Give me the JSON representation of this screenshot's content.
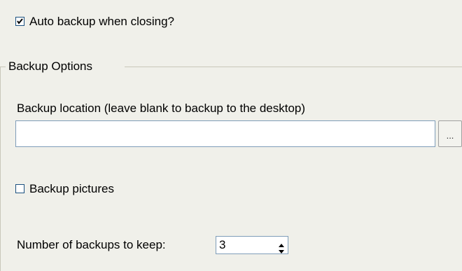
{
  "auto_backup": {
    "label": "Auto backup when closing?",
    "checked": true
  },
  "backup_options": {
    "group_title": "Backup Options",
    "location_label": "Backup location (leave blank to backup to the desktop)",
    "location_value": "",
    "browse_label": "...",
    "backup_pictures_label": "Backup pictures",
    "backup_pictures_checked": false,
    "num_backups_label": "Number of backups to keep:",
    "num_backups_value": "3"
  },
  "colors": {
    "background": "#f0f0ea",
    "checkbox_border": "#1c5180",
    "field_border": "#7f9db9",
    "groupbox_line": "#c9c7ba"
  },
  "icons": {
    "check": "checkmark-icon",
    "spin_up": "triangle-up-icon",
    "spin_down": "triangle-down-icon"
  }
}
